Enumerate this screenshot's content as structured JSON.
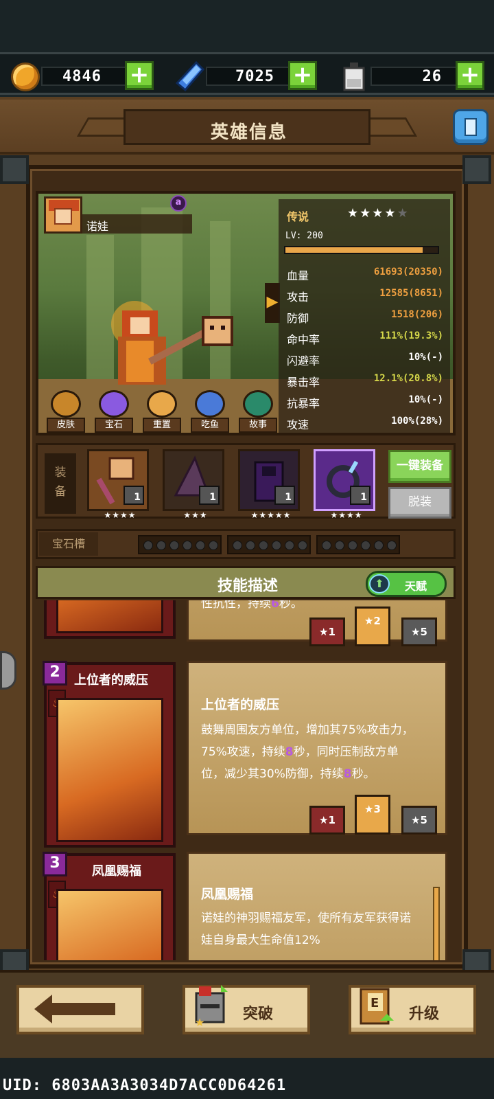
{
  "resources": {
    "gold": {
      "icon": "gold-coin-icon",
      "value": "4846",
      "add_label": "+"
    },
    "gem": {
      "icon": "blue-crystal-icon",
      "value": "7025",
      "add_label": "+"
    },
    "potion": {
      "icon": "potion-bottle-icon",
      "value": "26",
      "add_label": "+"
    }
  },
  "header": {
    "title": "英雄信息",
    "save_icon": "floppy-disk-icon"
  },
  "hero": {
    "name": "诺娃",
    "rank_badge": "a",
    "rarity": "传说",
    "stars_filled": 4,
    "stars_total": 5,
    "level_label": "LV: 200",
    "level_progress": 0.9,
    "stats": [
      {
        "key": "血量",
        "value": "61693(20350)",
        "color": "#f0a040"
      },
      {
        "key": "攻击",
        "value": "12585(8651)",
        "color": "#f0a040"
      },
      {
        "key": "防御",
        "value": "1518(206)",
        "color": "#f0a040"
      },
      {
        "key": "命中率",
        "value": "111%(19.3%)",
        "color": "#d6d84a"
      },
      {
        "key": "闪避率",
        "value": "10%(-)",
        "color": "#ffffff"
      },
      {
        "key": "暴击率",
        "value": "12.1%(20.8%)",
        "color": "#d6d84a"
      },
      {
        "key": "抗暴率",
        "value": "10%(-)",
        "color": "#ffffff"
      },
      {
        "key": "攻速",
        "value": "100%(28%)",
        "color": "#ffffff"
      }
    ],
    "actions": [
      {
        "label": "皮肤",
        "icon": "shirt-icon"
      },
      {
        "label": "宝石",
        "icon": "gem-orb-icon"
      },
      {
        "label": "重置",
        "icon": "reset-scroll-icon"
      },
      {
        "label": "吃鱼",
        "icon": "fish-icon"
      },
      {
        "label": "故事",
        "icon": "book-icon"
      }
    ]
  },
  "equipment": {
    "label": "装备",
    "slots": [
      {
        "item": "weapon-staff",
        "count": "1",
        "stars": "★★★★"
      },
      {
        "item": "hat",
        "count": "1",
        "stars": "★★★"
      },
      {
        "item": "cloak",
        "count": "1",
        "stars": "★★★★★"
      },
      {
        "item": "ring",
        "count": "1",
        "stars": "★★★★"
      }
    ],
    "equip_all": "一键装备",
    "unequip": "脱装"
  },
  "gems": {
    "label": "宝石槽",
    "groups": 3,
    "slots_per_group": 6
  },
  "skills": {
    "header": "技能描述",
    "talent_label": "天赋",
    "partial_text": "性抗性，持续",
    "partial_num": "6",
    "partial_end": "秒。",
    "partial_badges": [
      "1",
      "2",
      "5"
    ],
    "items": [
      {
        "number": "2",
        "title": "上位者的威压",
        "desc_title": "上位者的威压",
        "desc_a": "鼓舞周围友方单位，增加其75%攻击力，75%攻速，持续",
        "desc_num1": "8",
        "desc_b": "秒，同时压制敌方单位，减少其30%防御，持续",
        "desc_num2": "8",
        "desc_c": "秒。",
        "badges": [
          "1",
          "3",
          "5"
        ]
      },
      {
        "number": "3",
        "title": "凤凰赐福",
        "desc_title": "凤凰赐福",
        "desc_a": "诺娃的神羽赐福友军，使所有友军获得诺娃自身最大生命值12%"
      }
    ]
  },
  "nav": {
    "back_icon": "back-arrow-icon",
    "breakthrough": "突破",
    "upgrade": "升级"
  },
  "uid": "UID: 6803AA3A3034D7ACC0D64261"
}
